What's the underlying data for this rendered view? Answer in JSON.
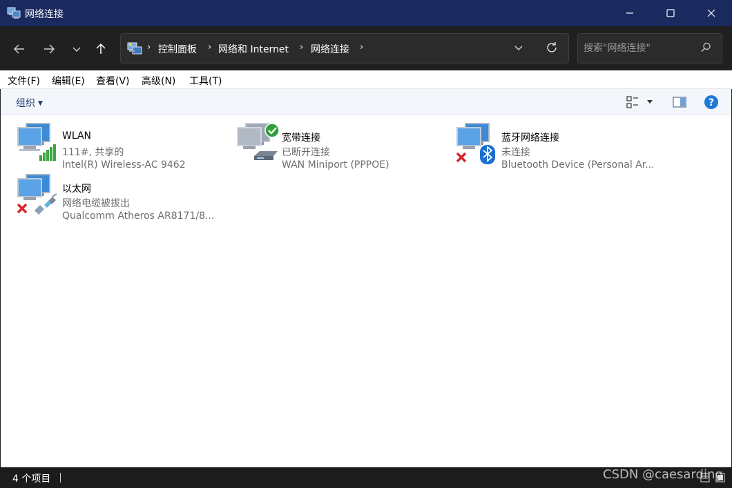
{
  "window": {
    "title": "网络连接",
    "minimize_icon": "minimize-icon",
    "maximize_icon": "maximize-icon",
    "close_icon": "close-icon"
  },
  "nav": {
    "breadcrumbs": [
      "控制面板",
      "网络和 Internet",
      "网络连接"
    ],
    "search_placeholder": "搜索\"网络连接\"",
    "search_value": ""
  },
  "menu": [
    "文件(F)",
    "编辑(E)",
    "查看(V)",
    "高级(N)",
    "工具(T)"
  ],
  "command_bar": {
    "organize": "组织"
  },
  "connections": [
    {
      "name": "WLAN",
      "status": "111#, 共享的",
      "device": "Intel(R) Wireless-AC 9462",
      "icon": "wlan-signal-icon"
    },
    {
      "name": "宽带连接",
      "status": "已断开连接",
      "device": "WAN Miniport (PPPOE)",
      "icon": "broadband-connected-icon"
    },
    {
      "name": "蓝牙网络连接",
      "status": "未连接",
      "device": "Bluetooth Device (Personal Ar...",
      "icon": "bluetooth-disconnected-icon"
    },
    {
      "name": "以太网",
      "status": "网络电缆被拔出",
      "device": "Qualcomm Atheros AR8171/8...",
      "icon": "ethernet-unplugged-icon"
    }
  ],
  "status": {
    "count": "4 个项目"
  },
  "watermark": "CSDN @caesarding"
}
